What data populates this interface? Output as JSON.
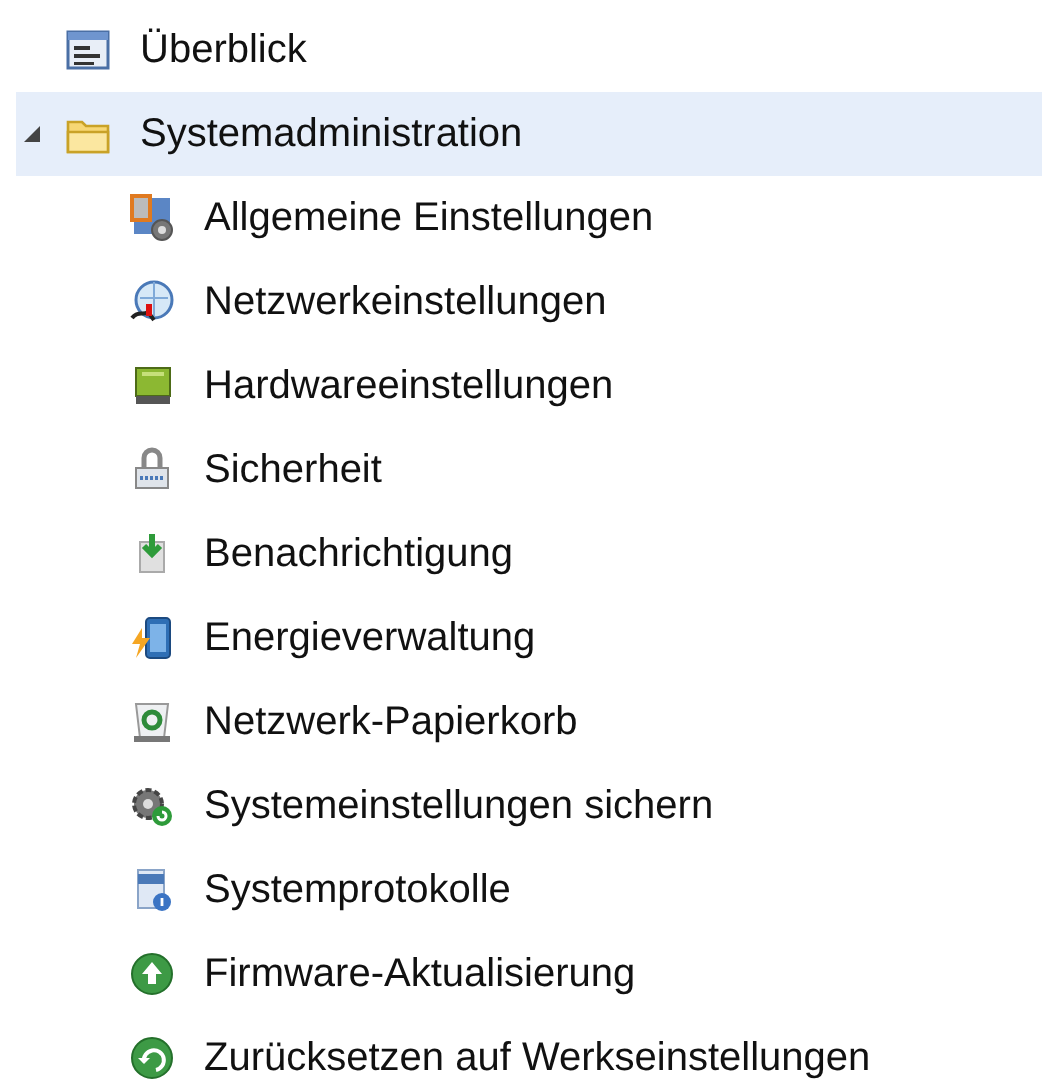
{
  "tree": [
    {
      "label": "Überblick",
      "selected": false
    },
    {
      "label": "Systemadministration",
      "selected": true,
      "expanded": true,
      "children": [
        {
          "label": "Allgemeine Einstellungen",
          "selected": false
        },
        {
          "label": "Netzwerkeinstellungen",
          "selected": false
        },
        {
          "label": "Hardwareeinstellungen",
          "selected": false
        },
        {
          "label": "Sicherheit",
          "selected": false
        },
        {
          "label": "Benachrichtigung",
          "selected": false
        },
        {
          "label": "Energieverwaltung",
          "selected": false
        },
        {
          "label": "Netzwerk-Papierkorb",
          "selected": false
        },
        {
          "label": "Systemeinstellungen sichern",
          "selected": false
        },
        {
          "label": "Systemprotokolle",
          "selected": false
        },
        {
          "label": "Firmware-Aktualisierung",
          "selected": false
        },
        {
          "label": "Zurücksetzen auf Werkseinstellungen",
          "selected": false
        }
      ]
    }
  ]
}
